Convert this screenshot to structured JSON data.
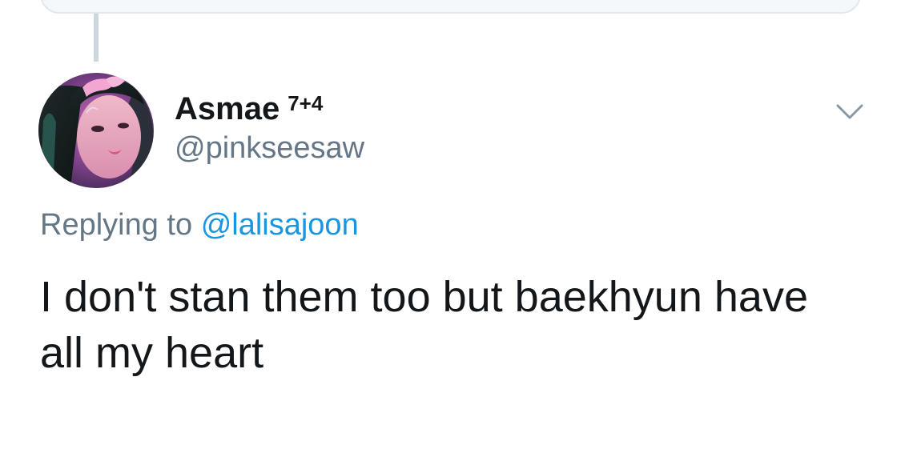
{
  "tweet": {
    "author": {
      "display_name": "Asmae",
      "name_suffix": "7+4",
      "handle": "@pinkseesaw"
    },
    "replying_prefix": "Replying to",
    "replying_to": "@lalisajoon",
    "text": "I don't stan them too but baekhyun have all my heart"
  },
  "icons": {
    "menu": "chevron-down-icon",
    "avatar": "profile-photo"
  },
  "colors": {
    "primary_text": "#14171a",
    "secondary_text": "#657786",
    "link": "#1b95e0",
    "thread_line": "#ccd6dd",
    "quoted_card_border": "#e1e8ed"
  }
}
